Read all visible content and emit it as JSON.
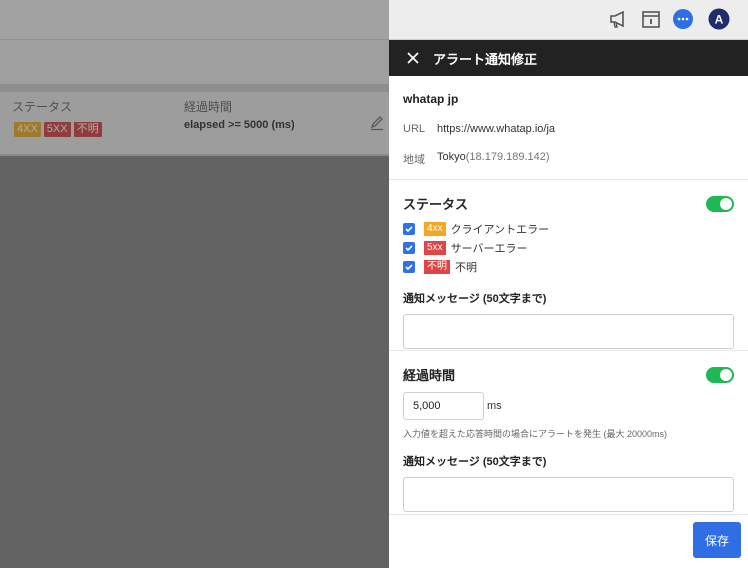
{
  "header": {
    "icons": [
      "megaphone-icon",
      "calendar-info-icon",
      "chat-bubble-icon",
      "avatar"
    ],
    "avatar_initial": "A"
  },
  "background_table": {
    "columns": [
      "ステータス",
      "経過時間"
    ],
    "row": {
      "tags": [
        {
          "label": "4XX",
          "color": "#e8a317"
        },
        {
          "label": "5XX",
          "color": "#cc3333"
        },
        {
          "label": "不明",
          "color": "#cc3333"
        }
      ],
      "elapsed": "elapsed >= 5000 (ms)"
    }
  },
  "drawer": {
    "title": "アラート通知修正",
    "site_name": "whatap jp",
    "url_label": "URL",
    "url_value": "https://www.whatap.io/ja",
    "region_label": "地域",
    "region_value": "Tokyo",
    "region_ip": "(18.179.189.142)",
    "status_section": {
      "title": "ステータス",
      "enabled": true,
      "options": [
        {
          "badge": "4xx",
          "badge_color": "#f5a623",
          "label": "クライアントエラー",
          "checked": true
        },
        {
          "badge": "5xx",
          "badge_color": "#e04545",
          "label": "サーバーエラー",
          "checked": true
        },
        {
          "badge": "不明",
          "badge_color": "#e04545",
          "label": "不明",
          "checked": true
        }
      ],
      "message_label": "通知メッセージ (50文字まで)",
      "message_value": ""
    },
    "elapsed_section": {
      "title": "経過時間",
      "enabled": true,
      "value": "5,000",
      "unit": "ms",
      "hint": "入力値を超えた応答時間の場合にアラートを発生 (最大 20000ms)",
      "message_label": "通知メッセージ (50文字まで)",
      "message_value": ""
    },
    "save_label": "保存"
  },
  "colors": {
    "accent": "#2f6fe3",
    "toggle_on": "#1db954",
    "checkbox": "#2e72e8",
    "drawer_header": "#222222"
  }
}
